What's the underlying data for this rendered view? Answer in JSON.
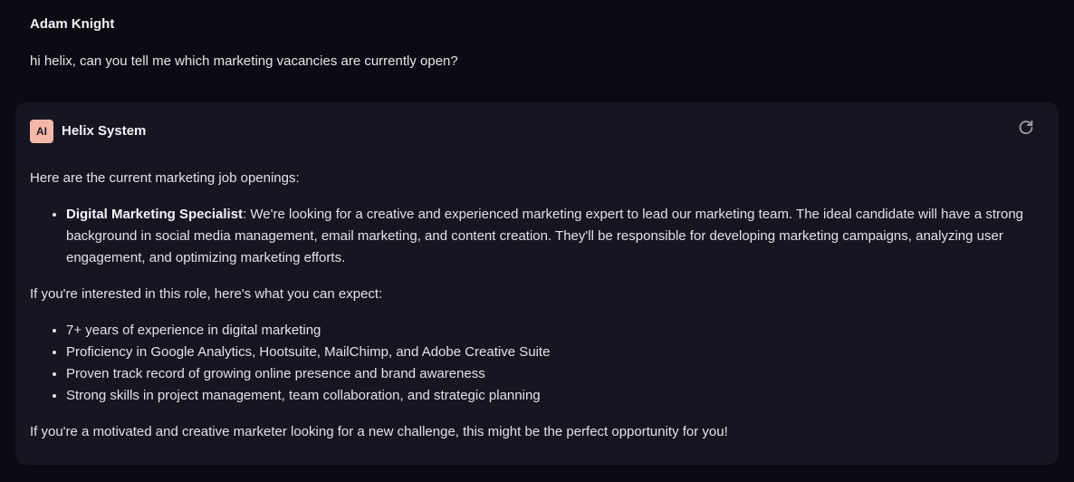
{
  "user_message": {
    "author": "Adam Knight",
    "text": "hi helix, can you tell me which marketing vacancies are currently open?"
  },
  "ai_message": {
    "avatar_label": "AI",
    "author": "Helix System",
    "refresh_icon": "refresh-icon",
    "intro": "Here are the current marketing job openings:",
    "job": {
      "title": "Digital Marketing Specialist",
      "description": ": We're looking for a creative and experienced marketing expert to lead our marketing team. The ideal candidate will have a strong background in social media management, email marketing, and content creation. They'll be responsible for developing marketing campaigns, analyzing user engagement, and optimizing marketing efforts."
    },
    "expect_intro": "If you're interested in this role, here's what you can expect:",
    "requirements": [
      "7+ years of experience in digital marketing",
      "Proficiency in Google Analytics, Hootsuite, MailChimp, and Adobe Creative Suite",
      "Proven track record of growing online presence and brand awareness",
      "Strong skills in project management, team collaboration, and strategic planning"
    ],
    "closing": "If you're a motivated and creative marketer looking for a new challenge, this might be the perfect opportunity for you!"
  },
  "colors": {
    "background": "#0b0b14",
    "card": "#161622",
    "avatar": "#f4b8a8"
  }
}
